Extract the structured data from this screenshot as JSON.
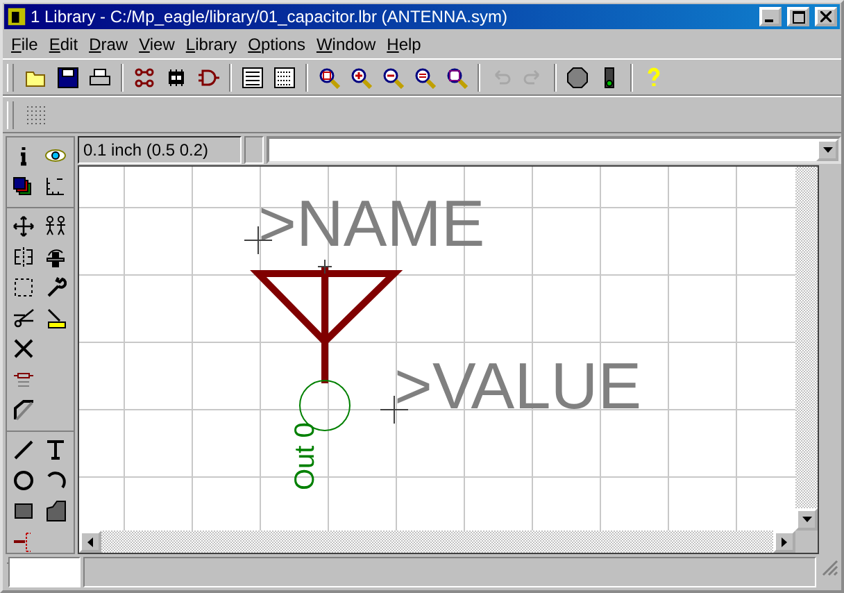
{
  "window": {
    "title": "1 Library - C:/Mp_eagle/library/01_capacitor.lbr (ANTENNA.sym)"
  },
  "menu": [
    "File",
    "Edit",
    "Draw",
    "View",
    "Library",
    "Options",
    "Window",
    "Help"
  ],
  "toolbar": [
    [
      {
        "kind": "open",
        "disabled": false
      },
      {
        "kind": "save",
        "disabled": false
      },
      {
        "kind": "print",
        "disabled": false
      }
    ],
    [
      {
        "kind": "board",
        "disabled": false
      },
      {
        "kind": "chip",
        "disabled": false
      },
      {
        "kind": "gate",
        "disabled": false
      }
    ],
    [
      {
        "kind": "script",
        "disabled": false
      },
      {
        "kind": "ulp",
        "disabled": false
      }
    ],
    [
      {
        "kind": "zoom-fit",
        "disabled": false
      },
      {
        "kind": "zoom-in",
        "disabled": false
      },
      {
        "kind": "zoom-out",
        "disabled": false
      },
      {
        "kind": "zoom-redraw",
        "disabled": false
      },
      {
        "kind": "zoom-select",
        "disabled": false
      }
    ],
    [
      {
        "kind": "undo",
        "disabled": true
      },
      {
        "kind": "redo",
        "disabled": true
      }
    ],
    [
      {
        "kind": "stop",
        "disabled": false
      },
      {
        "kind": "go",
        "disabled": false
      }
    ],
    [
      {
        "kind": "help",
        "disabled": false
      }
    ]
  ],
  "toolbox": [
    [
      [
        {
          "kind": "info"
        },
        {
          "kind": "eye"
        }
      ],
      [
        {
          "kind": "layers"
        },
        {
          "kind": "grid"
        }
      ]
    ],
    [
      [
        {
          "kind": "move"
        },
        {
          "kind": "copy"
        }
      ],
      [
        {
          "kind": "mirror"
        },
        {
          "kind": "rotate"
        }
      ],
      [
        {
          "kind": "group"
        },
        {
          "kind": "wrench"
        }
      ],
      [
        {
          "kind": "scissors"
        },
        {
          "kind": "paste"
        }
      ],
      [
        {
          "kind": "delete"
        }
      ],
      [
        {
          "kind": "name"
        }
      ],
      [
        {
          "kind": "miter"
        }
      ]
    ],
    [
      [
        {
          "kind": "line"
        },
        {
          "kind": "text"
        }
      ],
      [
        {
          "kind": "circle"
        },
        {
          "kind": "arc"
        }
      ],
      [
        {
          "kind": "rect"
        },
        {
          "kind": "polygon"
        }
      ],
      [
        {
          "kind": "pin"
        }
      ]
    ]
  ],
  "coordinate": "0.1 inch (0.5 0.2)",
  "canvas": {
    "name_label": ">NAME",
    "value_label": ">VALUE",
    "pin_name": "Out 0"
  }
}
